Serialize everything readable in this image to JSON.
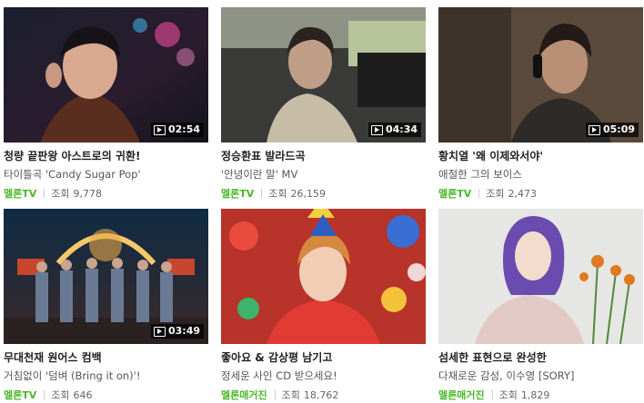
{
  "accent_color": "#4cb82a",
  "play_icon": "play-icon",
  "videos": [
    {
      "title": "청량 끝판왕 아스트로의 귀환!",
      "subtitle": "타이틀곡 'Candy Sugar Pop'",
      "source": "멜론TV",
      "views_label": "조회",
      "views": "9,778",
      "duration": "02:54"
    },
    {
      "title": "정승환표 발라드곡",
      "subtitle": "'안녕이란 말' MV",
      "source": "멜론TV",
      "views_label": "조회",
      "views": "26,159",
      "duration": "04:34"
    },
    {
      "title": "황치열 '왜 이제와서야'",
      "subtitle": "애절한 그의 보이스",
      "source": "멜론TV",
      "views_label": "조회",
      "views": "2,473",
      "duration": "05:09"
    },
    {
      "title": "무대천재 원어스 컴백",
      "subtitle": "거침없이 '덤벼 (Bring it on)'!",
      "source": "멜론TV",
      "views_label": "조회",
      "views": "646",
      "duration": "03:49"
    },
    {
      "title": "좋아요 & 감상평 남기고",
      "subtitle": "정세운 사인 CD 받으세요!",
      "source": "멜론매거진",
      "views_label": "조회",
      "views": "18,762",
      "duration": ""
    },
    {
      "title": "섬세한 표현으로 완성한",
      "subtitle": "다채로운 감성, 이수영 [SORY]",
      "source": "멜론매거진",
      "views_label": "조회",
      "views": "1,829",
      "duration": ""
    }
  ]
}
